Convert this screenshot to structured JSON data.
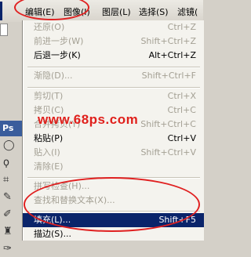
{
  "menubar": {
    "items": [
      "编辑(E)",
      "图像(I)",
      "图层(L)",
      "选择(S)",
      "滤镜("
    ],
    "active_index": 0
  },
  "left_panel": {
    "tab_label": "Ps"
  },
  "menu": {
    "items": [
      {
        "label": "还原(O)",
        "shortcut": "Ctrl+Z",
        "disabled": true
      },
      {
        "label": "前进一步(W)",
        "shortcut": "Shift+Ctrl+Z",
        "disabled": true
      },
      {
        "label": "后退一步(K)",
        "shortcut": "Alt+Ctrl+Z",
        "disabled": false
      },
      {
        "label": "渐隐(D)...",
        "shortcut": "Shift+Ctrl+F",
        "disabled": true
      },
      {
        "label": "剪切(T)",
        "shortcut": "Ctrl+X",
        "disabled": true
      },
      {
        "label": "拷贝(C)",
        "shortcut": "Ctrl+C",
        "disabled": true
      },
      {
        "label": "合并拷贝(Y)",
        "shortcut": "Shift+Ctrl+C",
        "disabled": true
      },
      {
        "label": "粘贴(P)",
        "shortcut": "Ctrl+V",
        "disabled": false
      },
      {
        "label": "贴入(I)",
        "shortcut": "Shift+Ctrl+V",
        "disabled": true
      },
      {
        "label": "清除(E)",
        "shortcut": "",
        "disabled": true
      },
      {
        "label": "拼写检查(H)...",
        "shortcut": "",
        "disabled": true
      },
      {
        "label": "查找和替换文本(X)...",
        "shortcut": "",
        "disabled": true
      },
      {
        "label": "填充(L)...",
        "shortcut": "Shift+F5",
        "disabled": false,
        "selected": true
      },
      {
        "label": "描边(S)...",
        "shortcut": "",
        "disabled": false
      }
    ]
  },
  "watermark": "www.68ps.com",
  "colors": {
    "selection": "#0a246a",
    "annotation": "#e02020",
    "watermark": "#e0201c"
  }
}
